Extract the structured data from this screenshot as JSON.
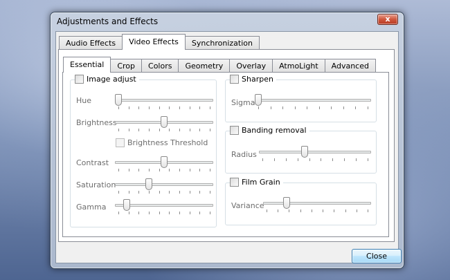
{
  "window": {
    "title": "Adjustments and Effects",
    "close_glyph": "x"
  },
  "outer_tabs": [
    {
      "label": "Audio Effects",
      "active": false
    },
    {
      "label": "Video Effects",
      "active": true
    },
    {
      "label": "Synchronization",
      "active": false
    }
  ],
  "inner_tabs": [
    {
      "label": "Essential",
      "active": true
    },
    {
      "label": "Crop",
      "active": false
    },
    {
      "label": "Colors",
      "active": false
    },
    {
      "label": "Geometry",
      "active": false
    },
    {
      "label": "Overlay",
      "active": false
    },
    {
      "label": "AtmoLight",
      "active": false
    },
    {
      "label": "Advanced",
      "active": false
    }
  ],
  "image_adjust": {
    "label": "Image adjust",
    "checked": false,
    "brightness_threshold_label": "Brightness Threshold",
    "sliders": [
      {
        "label": "Hue",
        "value": 0.0
      },
      {
        "label": "Brightness",
        "value": 0.5
      },
      {
        "label": "Contrast",
        "value": 0.5
      },
      {
        "label": "Saturation",
        "value": 0.33
      },
      {
        "label": "Gamma",
        "value": 0.09
      }
    ]
  },
  "sharpen": {
    "label": "Sharpen",
    "checked": false,
    "slider": {
      "label": "Sigma",
      "value": 0.0
    }
  },
  "banding": {
    "label": "Banding removal",
    "checked": false,
    "slider": {
      "label": "Radius",
      "value": 0.4
    }
  },
  "film_grain": {
    "label": "Film Grain",
    "checked": false,
    "slider": {
      "label": "Variance",
      "value": 0.2
    }
  },
  "buttons": {
    "close": "Close"
  },
  "colors": {
    "accent": "#3c7fb1",
    "frame": "#3a4a5e",
    "close_red": "#c94a2f"
  }
}
